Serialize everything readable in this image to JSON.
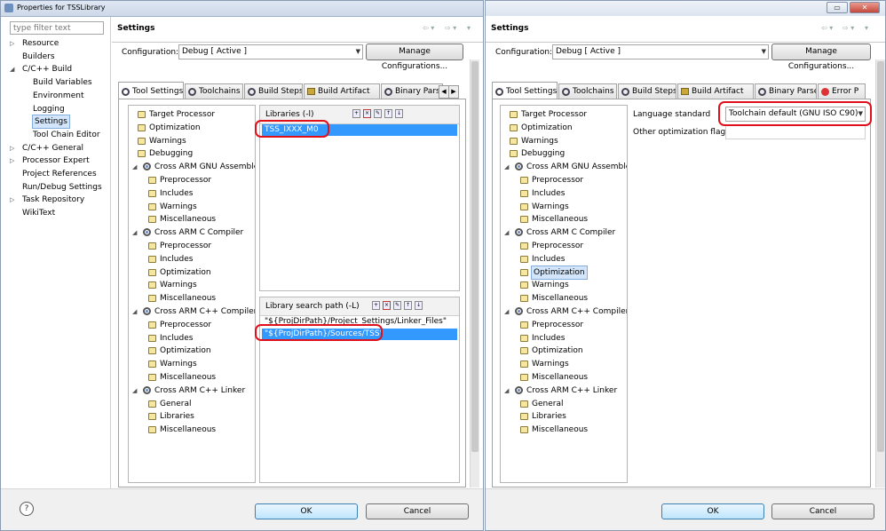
{
  "left": {
    "title": "Properties for TSSLibrary",
    "filter_placeholder": "type filter text",
    "nav": [
      {
        "label": "Resource",
        "indent": 0,
        "arrow": "▷"
      },
      {
        "label": "Builders",
        "indent": 0,
        "arrow": ""
      },
      {
        "label": "C/C++ Build",
        "indent": 0,
        "arrow": "◢"
      },
      {
        "label": "Build Variables",
        "indent": 1,
        "arrow": ""
      },
      {
        "label": "Environment",
        "indent": 1,
        "arrow": ""
      },
      {
        "label": "Logging",
        "indent": 1,
        "arrow": ""
      },
      {
        "label": "Settings",
        "indent": 1,
        "arrow": "",
        "selected": true
      },
      {
        "label": "Tool Chain Editor",
        "indent": 1,
        "arrow": ""
      },
      {
        "label": "C/C++ General",
        "indent": 0,
        "arrow": "▷"
      },
      {
        "label": "Processor Expert",
        "indent": 0,
        "arrow": "▷"
      },
      {
        "label": "Project References",
        "indent": 0,
        "arrow": ""
      },
      {
        "label": "Run/Debug Settings",
        "indent": 0,
        "arrow": ""
      },
      {
        "label": "Task Repository",
        "indent": 0,
        "arrow": "▷"
      },
      {
        "label": "WikiText",
        "indent": 0,
        "arrow": ""
      }
    ],
    "settings_title": "Settings",
    "config_label": "Configuration:",
    "config_value": "Debug  [ Active ]",
    "manage_label": "Manage Configurations...",
    "tabs": [
      "Tool Settings",
      "Toolchains",
      "Build Steps",
      "Build Artifact",
      "Binary Parsers"
    ],
    "libraries_title": "Libraries (-l)",
    "libraries": [
      "TSS_IXXX_M0"
    ],
    "search_title": "Library search path (-L)",
    "search_paths": [
      "\"${ProjDirPath}/Project_Settings/Linker_Files\"",
      "\"${ProjDirPath}/Sources/TSS\""
    ],
    "ok": "OK",
    "cancel": "Cancel",
    "help": "?"
  },
  "tool_tree": [
    {
      "label": "Target Processor",
      "level": 1,
      "icon": "folder"
    },
    {
      "label": "Optimization",
      "level": 1,
      "icon": "folder"
    },
    {
      "label": "Warnings",
      "level": 1,
      "icon": "folder"
    },
    {
      "label": "Debugging",
      "level": 1,
      "icon": "folder"
    },
    {
      "label": "Cross ARM GNU Assembler",
      "level": 0,
      "icon": "gear"
    },
    {
      "label": "Preprocessor",
      "level": 2,
      "icon": "folder"
    },
    {
      "label": "Includes",
      "level": 2,
      "icon": "folder"
    },
    {
      "label": "Warnings",
      "level": 2,
      "icon": "folder"
    },
    {
      "label": "Miscellaneous",
      "level": 2,
      "icon": "folder"
    },
    {
      "label": "Cross ARM C Compiler",
      "level": 0,
      "icon": "gear"
    },
    {
      "label": "Preprocessor",
      "level": 2,
      "icon": "folder"
    },
    {
      "label": "Includes",
      "level": 2,
      "icon": "folder"
    },
    {
      "label": "Optimization",
      "level": 2,
      "icon": "folder"
    },
    {
      "label": "Warnings",
      "level": 2,
      "icon": "folder"
    },
    {
      "label": "Miscellaneous",
      "level": 2,
      "icon": "folder"
    },
    {
      "label": "Cross ARM C++ Compiler",
      "level": 0,
      "icon": "gear"
    },
    {
      "label": "Preprocessor",
      "level": 2,
      "icon": "folder"
    },
    {
      "label": "Includes",
      "level": 2,
      "icon": "folder"
    },
    {
      "label": "Optimization",
      "level": 2,
      "icon": "folder"
    },
    {
      "label": "Warnings",
      "level": 2,
      "icon": "folder"
    },
    {
      "label": "Miscellaneous",
      "level": 2,
      "icon": "folder"
    },
    {
      "label": "Cross ARM C++ Linker",
      "level": 0,
      "icon": "gear"
    },
    {
      "label": "General",
      "level": 2,
      "icon": "folder"
    },
    {
      "label": "Libraries",
      "level": 2,
      "icon": "folder"
    },
    {
      "label": "Miscellaneous",
      "level": 2,
      "icon": "folder"
    }
  ],
  "right": {
    "settings_title": "Settings",
    "config_label": "Configuration:",
    "config_value": "Debug  [ Active ]",
    "manage_label": "Manage Configurations...",
    "tabs": [
      "Tool Settings",
      "Toolchains",
      "Build Steps",
      "Build Artifact",
      "Binary Parsers",
      "Error P"
    ],
    "lang_label": "Language standard",
    "lang_value": "Toolchain default (GNU ISO C90)",
    "other_label": "Other optimization flags",
    "ok": "OK",
    "cancel": "Cancel"
  }
}
